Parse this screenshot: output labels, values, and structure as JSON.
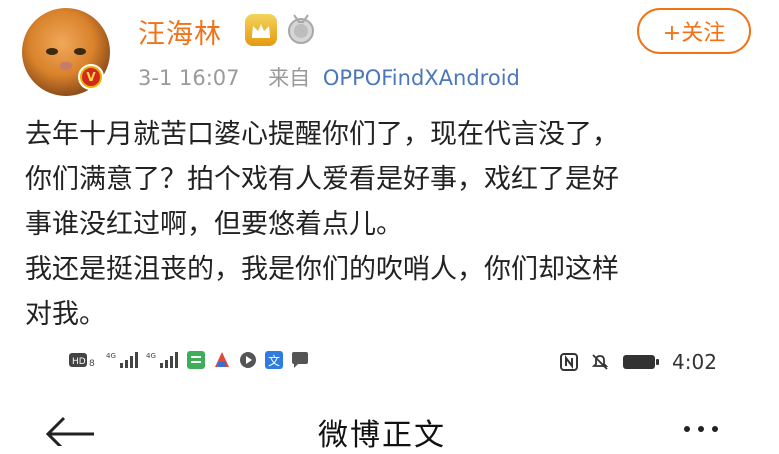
{
  "post": {
    "author_name": "汪海林",
    "time": "3-1 16:07",
    "source_prefix": "来自",
    "device": "OPPOFindXAndroid",
    "follow_label": "+关注",
    "verified_mark": "V",
    "lines": [
      "去年十月就苦口婆心提醒你们了，现在代言没了，",
      "你们满意了？拍个戏有人爱看是好事，戏红了是好",
      "事谁没红过啊，但要悠着点儿。",
      "我还是挺沮丧的，我是你们的吹哨人，你们却这样",
      "对我。"
    ]
  },
  "status_bar": {
    "time": "4:02",
    "icons": [
      "hd-icon",
      "signal-4g-icon",
      "signal-4g-icon",
      "app-icon",
      "app-icon",
      "app-icon",
      "translate-icon",
      "chat-icon",
      "nfc-icon",
      "mute-icon",
      "battery-icon"
    ]
  },
  "nav": {
    "title": "微博正文"
  },
  "colors": {
    "accent": "#f07318",
    "link": "#4a78b8",
    "meta": "#9a9a9a"
  }
}
